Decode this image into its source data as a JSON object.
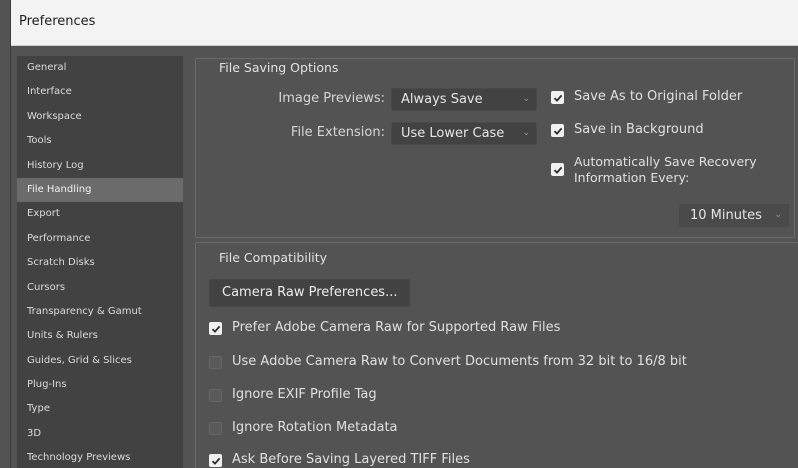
{
  "window": {
    "title": "Preferences"
  },
  "sidebar": {
    "items": [
      {
        "label": "General"
      },
      {
        "label": "Interface"
      },
      {
        "label": "Workspace"
      },
      {
        "label": "Tools"
      },
      {
        "label": "History Log"
      },
      {
        "label": "File Handling",
        "active": true
      },
      {
        "label": "Export"
      },
      {
        "label": "Performance"
      },
      {
        "label": "Scratch Disks"
      },
      {
        "label": "Cursors"
      },
      {
        "label": "Transparency & Gamut"
      },
      {
        "label": "Units & Rulers"
      },
      {
        "label": "Guides, Grid & Slices"
      },
      {
        "label": "Plug-Ins"
      },
      {
        "label": "Type"
      },
      {
        "label": "3D"
      },
      {
        "label": "Technology Previews"
      }
    ]
  },
  "file_saving": {
    "title": "File Saving Options",
    "image_previews_label": "Image Previews:",
    "image_previews_value": "Always Save",
    "file_extension_label": "File Extension:",
    "file_extension_value": "Use Lower Case",
    "save_as_original": {
      "label": "Save As to Original Folder",
      "checked": true
    },
    "save_background": {
      "label": "Save in Background",
      "checked": true
    },
    "auto_save": {
      "label_line1": "Automatically Save Recovery",
      "label_line2": "Information Every:",
      "checked": true
    },
    "interval_value": "10 Minutes"
  },
  "file_compat": {
    "title": "File Compatibility",
    "camera_raw_button": "Camera Raw Preferences...",
    "options": [
      {
        "label": "Prefer Adobe Camera Raw for Supported Raw Files",
        "checked": true
      },
      {
        "label": "Use Adobe Camera Raw to Convert Documents from 32 bit to 16/8 bit",
        "checked": false
      },
      {
        "label": "Ignore EXIF Profile Tag",
        "checked": false
      },
      {
        "label": "Ignore Rotation Metadata",
        "checked": false
      },
      {
        "label": "Ask Before Saving Layered TIFF Files",
        "checked": true
      }
    ]
  },
  "icons": {
    "checkmark": "checkmark-icon",
    "dropdown": "chevron-down-icon"
  },
  "colors": {
    "panel_bg": "#535353",
    "sidebar_bg": "#424242",
    "active_item": "#6b6b6b",
    "titlebar_bg": "#f3f3f3"
  }
}
